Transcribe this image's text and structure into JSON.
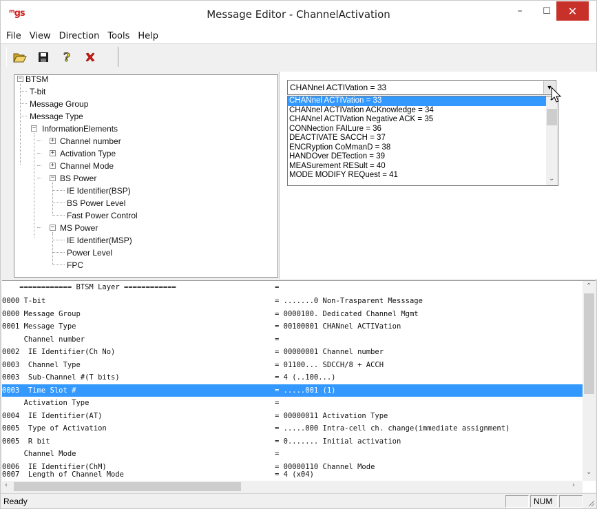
{
  "window": {
    "logo": "ᵐgs",
    "title": "Message Editor - ChannelActivation",
    "minimize": "–",
    "maximize": "☐",
    "close": "✕"
  },
  "menu": [
    "File",
    "View",
    "Direction",
    "Tools",
    "Help"
  ],
  "toolbar": {
    "icons": [
      "open-folder-icon",
      "save-icon",
      "help-icon",
      "delete-icon"
    ]
  },
  "tree": {
    "nodes": [
      {
        "label": "BTSM"
      },
      {
        "label": "T-bit"
      },
      {
        "label": "Message Group"
      },
      {
        "label": "Message Type"
      },
      {
        "label": "InformationElements"
      },
      {
        "label": "Channel number"
      },
      {
        "label": "Activation Type"
      },
      {
        "label": "Channel Mode"
      },
      {
        "label": "BS Power"
      },
      {
        "label": "IE Identifier(BSP)"
      },
      {
        "label": "BS Power Level"
      },
      {
        "label": "Fast Power Control"
      },
      {
        "label": "MS Power"
      },
      {
        "label": "IE Identifier(MSP)"
      },
      {
        "label": "Power Level"
      },
      {
        "label": "FPC"
      }
    ],
    "box_symbols": {
      "expanded": "−",
      "collapsed": "+"
    }
  },
  "message_type_combo": {
    "value": "CHANnel ACTIVation = 33",
    "options": [
      "CHANnel ACTIVation = 33",
      "CHANnel ACTIVation ACKnowledge = 34",
      "CHANnel ACTIVation Negative ACK = 35",
      "CONNection FAILure = 36",
      "DEACTIVATE SACCH = 37",
      "ENCRyption CoMmanD = 38",
      "HANDOver DETection = 39",
      "MEASurement RESult = 40",
      "MODE MODIFY REQuest = 41"
    ],
    "selected_index": 0
  },
  "listing": {
    "rows": [
      {
        "left": "    ============ BTSM Layer ============",
        "right": "="
      },
      {
        "left": "0000 T-bit",
        "right": "= .......0 Non-Trasparent Messsage"
      },
      {
        "left": "0000 Message Group",
        "right": "= 0000100. Dedicated Channel Mgmt"
      },
      {
        "left": "0001 Message Type",
        "right": "= 00100001 CHANnel ACTIVation"
      },
      {
        "left": "     Channel number",
        "right": "="
      },
      {
        "left": "0002  IE Identifier(Ch No)",
        "right": "= 00000001 Channel number"
      },
      {
        "left": "0003  Channel Type",
        "right": "= 01100... SDCCH/8 + ACCH"
      },
      {
        "left": "0003  Sub-Channel #(T bits)",
        "right": "= 4 (..100...)"
      },
      {
        "left": "0003  Time Slot #",
        "right": "= .....001 (1)"
      },
      {
        "left": "     Activation Type",
        "right": "="
      },
      {
        "left": "0004  IE Identifier(AT)",
        "right": "= 00000011 Activation Type"
      },
      {
        "left": "0005  Type of Activation",
        "right": "= .....000 Intra-cell ch. change(immediate assignment)"
      },
      {
        "left": "0005  R bit",
        "right": "= 0....... Initial activation"
      },
      {
        "left": "     Channel Mode",
        "right": "="
      },
      {
        "left": "0006  IE Identifier(ChM)",
        "right": "= 00000110 Channel Mode"
      },
      {
        "left": "0007  Length of Channel Mode",
        "right": "= 4 (x04)"
      }
    ],
    "selected_index": 8
  },
  "status": {
    "text": "Ready",
    "indicator_1": "",
    "indicator_2": "NUM",
    "indicator_3": ""
  }
}
